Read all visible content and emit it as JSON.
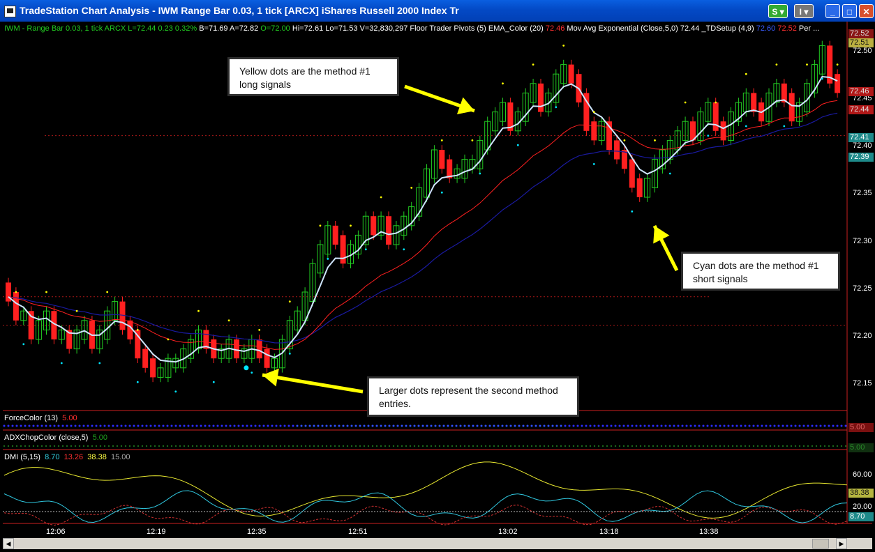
{
  "window": {
    "title": "TradeStation Chart Analysis - IWM Range Bar 0.03, 1 tick [ARCX] iShares Russell 2000 Index Tr",
    "btn_s": "S",
    "btn_i": "I"
  },
  "infobar": {
    "symbol": "IWM - Range Bar 0.03, 1 tick",
    "exchange": "ARCX",
    "last": "L=72.44",
    "change": "0.23",
    "pct": "0.32%",
    "bid": "B=71.69",
    "ask": "A=72.82",
    "open": "O=72.00",
    "high": "Hi=72.61",
    "low": "Lo=71.53",
    "volume": "V=32,830,297",
    "pivots": "Floor Trader Pivots (5)",
    "ema": "EMA_Color (20)",
    "ema_val": "72.46",
    "mavg": "Mov Avg Exponential (Close,5,0)",
    "mavg_val": "72.44",
    "td": "_TDSetup (4,9)",
    "td_val1": "72.60",
    "td_val2": "72.52",
    "per": "Per ..."
  },
  "subgraphs": {
    "force": "ForceColor (13)",
    "force_val": "5.00",
    "adx": "ADXChopColor (close,5)",
    "adx_val": "5.00",
    "dmi": "DMI (5,15)",
    "dmi_v1": "8.70",
    "dmi_v2": "13.26",
    "dmi_v3": "38.38",
    "dmi_v4": "15.00"
  },
  "price_scale": [
    "72.50",
    "72.45",
    "72.40",
    "72.35",
    "72.30",
    "72.25",
    "72.20",
    "72.15"
  ],
  "price_tags": {
    "t1": "72.52",
    "t2": "72.51",
    "t3": "72.46",
    "t4": "72.44",
    "t5": "72.41",
    "t6": "72.39",
    "force_tag": "5.00",
    "adx_tag": "5.00"
  },
  "dmi_scale": [
    "60.00",
    "20.00"
  ],
  "dmi_tags": {
    "a": "38.38",
    "b": "8.70"
  },
  "time_axis": [
    "12:06",
    "12:19",
    "12:35",
    "12:51",
    "13:02",
    "13:18",
    "13:38"
  ],
  "callouts": {
    "yellow": "Yellow dots are the method #1 long signals",
    "cyan": "Cyan dots are the method #1 short signals",
    "large": "Larger dots represent the second method entries."
  },
  "colors": {
    "up_bar": "#22cc22",
    "down_bar": "#ff2020",
    "ema20": "#ff2020",
    "ema5": "#cfe6ff",
    "td_line": "#1a1aa0",
    "long_dot": "#ffff00",
    "short_dot": "#00e5ff",
    "arrow": "#ffff00"
  },
  "chart_data": {
    "type": "candlestick",
    "title": "IWM - Range Bar 0.03, 1 tick",
    "ylim": [
      72.12,
      72.52
    ],
    "close_series": [
      72.24,
      72.22,
      72.22,
      72.2,
      72.21,
      72.22,
      72.2,
      72.2,
      72.19,
      72.2,
      72.21,
      72.19,
      72.2,
      72.22,
      72.23,
      72.21,
      72.2,
      72.18,
      72.17,
      72.16,
      72.16,
      72.17,
      72.17,
      72.18,
      72.19,
      72.2,
      72.19,
      72.18,
      72.18,
      72.19,
      72.18,
      72.18,
      72.19,
      72.18,
      72.17,
      72.17,
      72.19,
      72.21,
      72.22,
      72.24,
      72.27,
      72.29,
      72.31,
      72.3,
      72.28,
      72.29,
      72.3,
      72.32,
      72.31,
      72.32,
      72.3,
      72.31,
      72.32,
      72.33,
      72.35,
      72.37,
      72.39,
      72.38,
      72.37,
      72.37,
      72.38,
      72.38,
      72.4,
      72.42,
      72.43,
      72.44,
      72.42,
      72.43,
      72.45,
      72.46,
      72.44,
      72.45,
      72.47,
      72.48,
      72.47,
      72.45,
      72.42,
      72.41,
      72.42,
      72.4,
      72.39,
      72.38,
      72.36,
      72.35,
      72.36,
      72.38,
      72.39,
      72.4,
      72.41,
      72.42,
      72.41,
      72.43,
      72.44,
      72.42,
      72.41,
      72.43,
      72.44,
      72.45,
      72.44,
      72.43,
      72.45,
      72.46,
      72.45,
      72.43,
      72.44,
      72.46,
      72.48,
      72.5,
      72.47,
      72.46
    ]
  }
}
